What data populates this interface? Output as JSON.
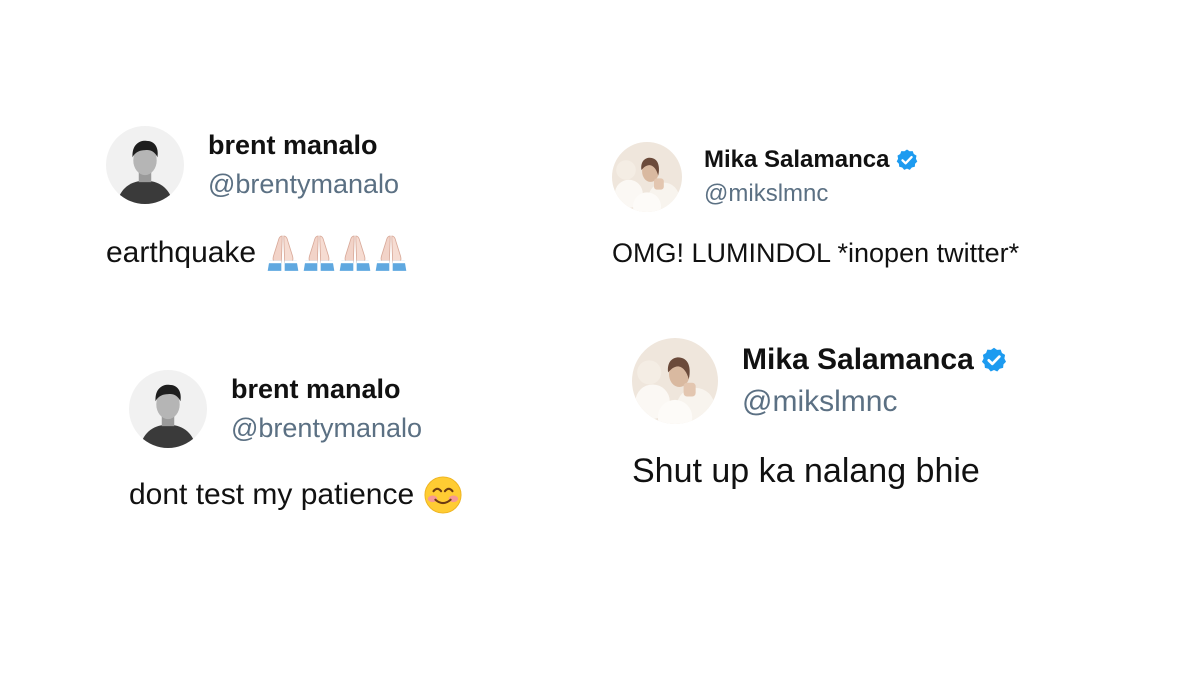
{
  "colors": {
    "background": "#ffffff",
    "text": "#111111",
    "handle": "#5b7083",
    "verified": "#1d9bf0",
    "emoji_skin": "#f2d3c8",
    "emoji_sleeve": "#5fa8e0",
    "emoji_face": "#ffcc33",
    "emoji_blush": "#f58fa5"
  },
  "tweets": [
    {
      "display_name": "brent manalo",
      "handle": "@brentymanalo",
      "verified": false,
      "text": "earthquake",
      "avatar_icon": "male-portrait-bw",
      "emojis": [
        "folded-hands-emoji",
        "folded-hands-emoji",
        "folded-hands-emoji",
        "folded-hands-emoji"
      ]
    },
    {
      "display_name": "Mika Salamanca",
      "handle": "@mikslmnc",
      "verified": true,
      "text": "OMG! LUMINDOL *inopen twitter*",
      "avatar_icon": "female-portrait-soft",
      "emojis": []
    },
    {
      "display_name": "brent manalo",
      "handle": "@brentymanalo",
      "verified": false,
      "text": "dont test my patience",
      "avatar_icon": "male-portrait-bw",
      "emojis": [
        "smiling-face-emoji"
      ]
    },
    {
      "display_name": "Mika Salamanca",
      "handle": "@mikslmnc",
      "verified": true,
      "text": "Shut up ka nalang bhie",
      "avatar_icon": "female-portrait-soft",
      "emojis": []
    }
  ]
}
